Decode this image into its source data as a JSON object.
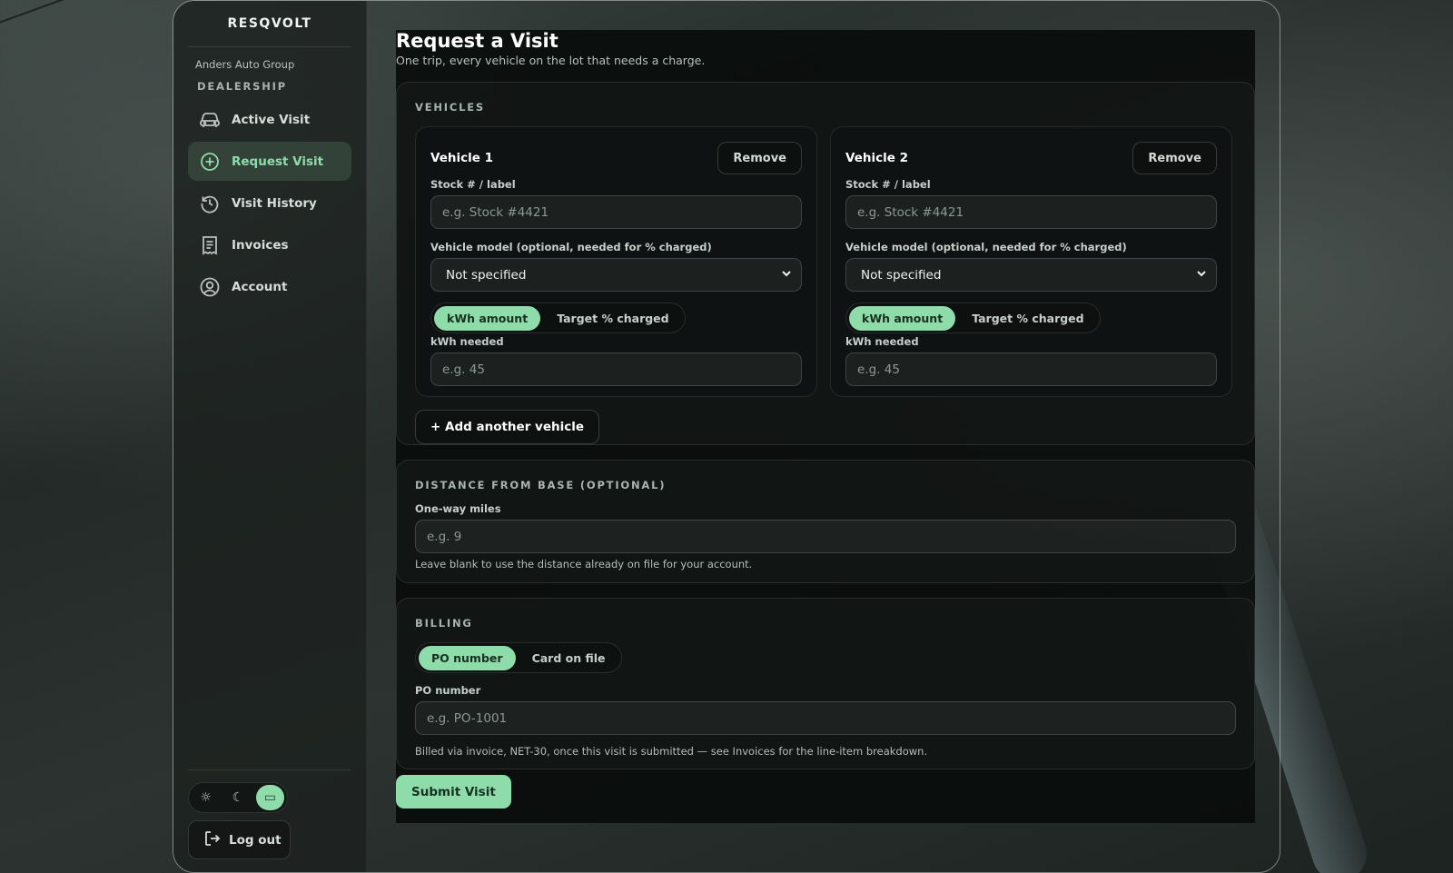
{
  "sidebar": {
    "brand": "RESQVOLT",
    "org": "Anders Auto Group",
    "section": "DEALERSHIP",
    "items": [
      {
        "label": "Active Visit",
        "icon": "car-icon"
      },
      {
        "label": "Request Visit",
        "icon": "plus-circle-icon",
        "active": true
      },
      {
        "label": "Visit History",
        "icon": "history-icon"
      },
      {
        "label": "Invoices",
        "icon": "receipt-icon"
      },
      {
        "label": "Account",
        "icon": "user-circle-icon"
      }
    ],
    "theme": {
      "options": [
        "sun-icon",
        "moon-icon",
        "system-icon"
      ],
      "selected": "system-icon"
    },
    "logout_label": "Log out"
  },
  "page": {
    "title": "Request a Visit",
    "subtitle": "One trip, every vehicle on the lot that needs a charge."
  },
  "vehicles": {
    "section_label": "VEHICLES",
    "items": [
      {
        "title": "Vehicle 1",
        "remove_label": "Remove",
        "stock_label": "Stock # / label",
        "stock_placeholder": "e.g. Stock #4421",
        "model_label": "Vehicle model (optional, needed for % charged)",
        "model_value": "Not specified",
        "mode_options": [
          "kWh amount",
          "Target % charged"
        ],
        "mode_selected": "kWh amount",
        "kwh_label": "kWh needed",
        "kwh_placeholder": "e.g. 45"
      },
      {
        "title": "Vehicle 2",
        "remove_label": "Remove",
        "stock_label": "Stock # / label",
        "stock_placeholder": "e.g. Stock #4421",
        "model_label": "Vehicle model (optional, needed for % charged)",
        "model_value": "Not specified",
        "mode_options": [
          "kWh amount",
          "Target % charged"
        ],
        "mode_selected": "kWh amount",
        "kwh_label": "kWh needed",
        "kwh_placeholder": "e.g. 45"
      }
    ],
    "add_label": "+ Add another vehicle"
  },
  "distance": {
    "section_label": "DISTANCE FROM BASE (OPTIONAL)",
    "field_label": "One-way miles",
    "placeholder": "e.g. 9",
    "help": "Leave blank to use the distance already on file for your account."
  },
  "billing": {
    "section_label": "BILLING",
    "options": [
      "PO number",
      "Card on file"
    ],
    "selected": "PO number",
    "field_label": "PO number",
    "placeholder": "e.g. PO-1001",
    "help": "Billed via invoice, NET-30, once this visit is submitted — see Invoices for the line-item breakdown."
  },
  "submit_label": "Submit Visit",
  "colors": {
    "accent": "#8fdcab",
    "accent_text": "#17301f",
    "panel": "#0b0e0d"
  }
}
